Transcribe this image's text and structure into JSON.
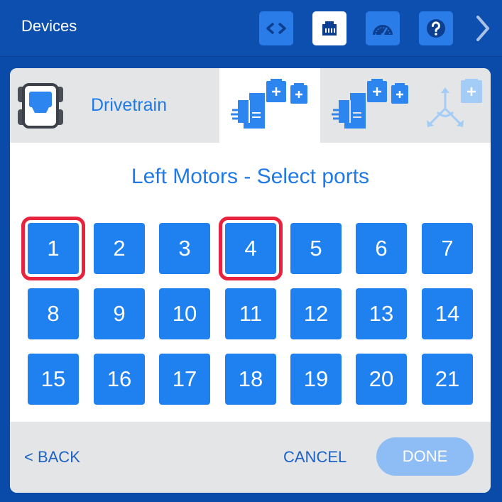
{
  "header": {
    "title": "Devices",
    "icons": [
      "code-icon",
      "ports-icon",
      "dashboard-icon",
      "help-icon",
      "chevron-right-icon"
    ]
  },
  "tabs": {
    "drivetrain_label": "Drivetrain",
    "selected_tab": "left-motors"
  },
  "heading": "Left Motors - Select ports",
  "ports": [
    "1",
    "2",
    "3",
    "4",
    "5",
    "6",
    "7",
    "8",
    "9",
    "10",
    "11",
    "12",
    "13",
    "14",
    "15",
    "16",
    "17",
    "18",
    "19",
    "20",
    "21"
  ],
  "selected_ports": [
    "1",
    "4"
  ],
  "footer": {
    "back_label": "< BACK",
    "cancel_label": "CANCEL",
    "done_label": "DONE"
  },
  "colors": {
    "header_bg": "#0d4fae",
    "accent": "#1f80f0",
    "selection": "#e8233d",
    "done_disabled": "#8dbdf4"
  }
}
